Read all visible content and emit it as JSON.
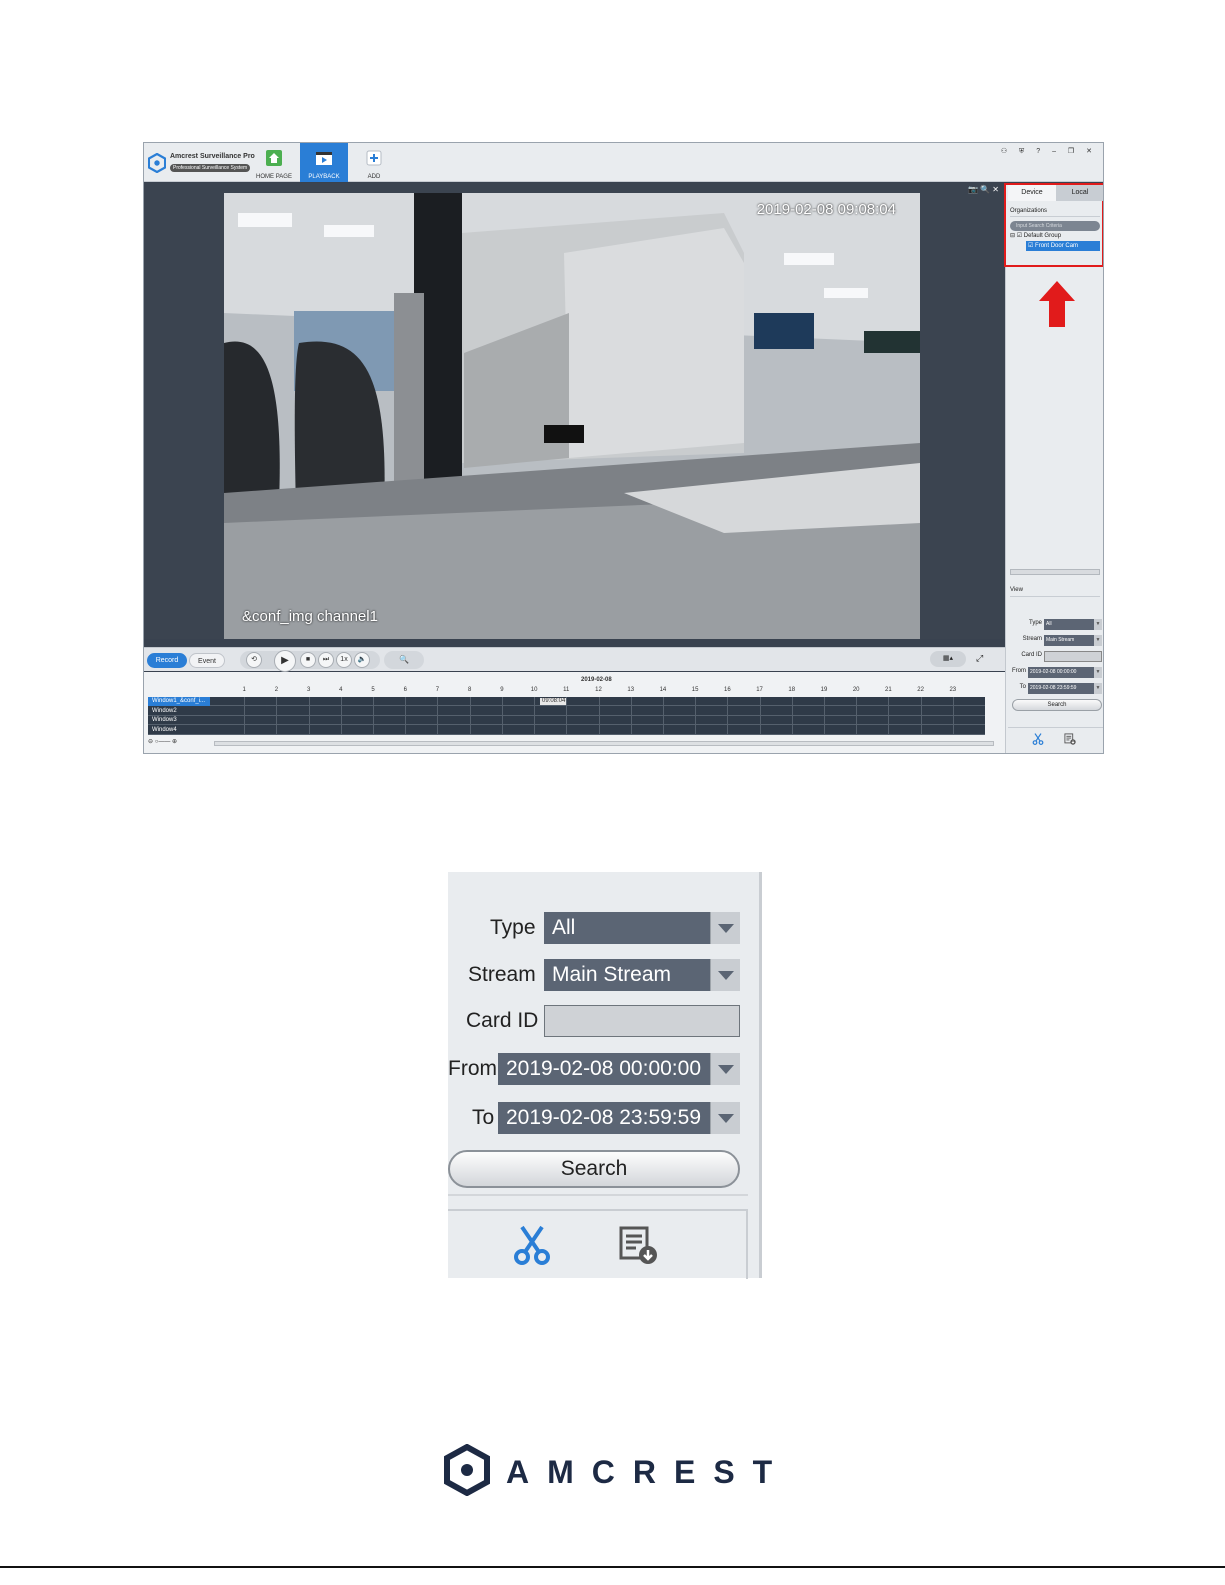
{
  "app": {
    "name": "Amcrest Surveillance Pro",
    "subtitle": "Professional Surveillance System"
  },
  "nav": {
    "home_label": "HOME PAGE",
    "playback_label": "PLAYBACK",
    "add_label": "ADD"
  },
  "window_controls": "⚇ ⛨ ? – ❐ ✕",
  "viewer": {
    "timestamp": "2019-02-08 09:08:04",
    "channel_label": "&conf_img channel1",
    "tools": "📷🔍✕"
  },
  "controls": {
    "record_label": "Record",
    "event_label": "Event",
    "zoom_glyph": "🔍",
    "fullscreen_glyph": "⤢"
  },
  "timeline": {
    "date": "2019-02-08",
    "hours": [
      "1",
      "2",
      "3",
      "4",
      "5",
      "6",
      "7",
      "8",
      "9",
      "10",
      "11",
      "12",
      "13",
      "14",
      "15",
      "16",
      "17",
      "18",
      "19",
      "20",
      "21",
      "22",
      "23"
    ],
    "windows": [
      "Window1_&conf_i...",
      "Window2",
      "Window3",
      "Window4"
    ],
    "marker": "09:08:04"
  },
  "right_panel": {
    "tab_device": "Device",
    "tab_local": "Local",
    "org_header": "Organizations",
    "search_placeholder": "Input Search Criteria",
    "group": "Default Group",
    "camera": "Front Door Cam",
    "view_label": "View",
    "type_label": "Type",
    "type_value": "All",
    "stream_label": "Stream",
    "stream_value": "Main Stream",
    "card_label": "Card ID",
    "from_label": "From",
    "from_value": "2019-02-08 00:00:00",
    "to_label": "To",
    "to_value": "2019-02-08 23:59:59",
    "search_label": "Search"
  },
  "zoom_panel": {
    "type_label": "Type",
    "type_value": "All",
    "stream_label": "Stream",
    "stream_value": "Main Stream",
    "card_label": "Card ID",
    "from_label": "From",
    "from_value": "2019-02-08 00:00:00",
    "to_label": "To",
    "to_value": "2019-02-08 23:59:59",
    "search_label": "Search"
  },
  "footer": {
    "brand": "AMCREST"
  },
  "colors": {
    "accent": "#2a7ed6",
    "highlight": "#e11b1b",
    "brand_navy": "#1d2a44"
  }
}
